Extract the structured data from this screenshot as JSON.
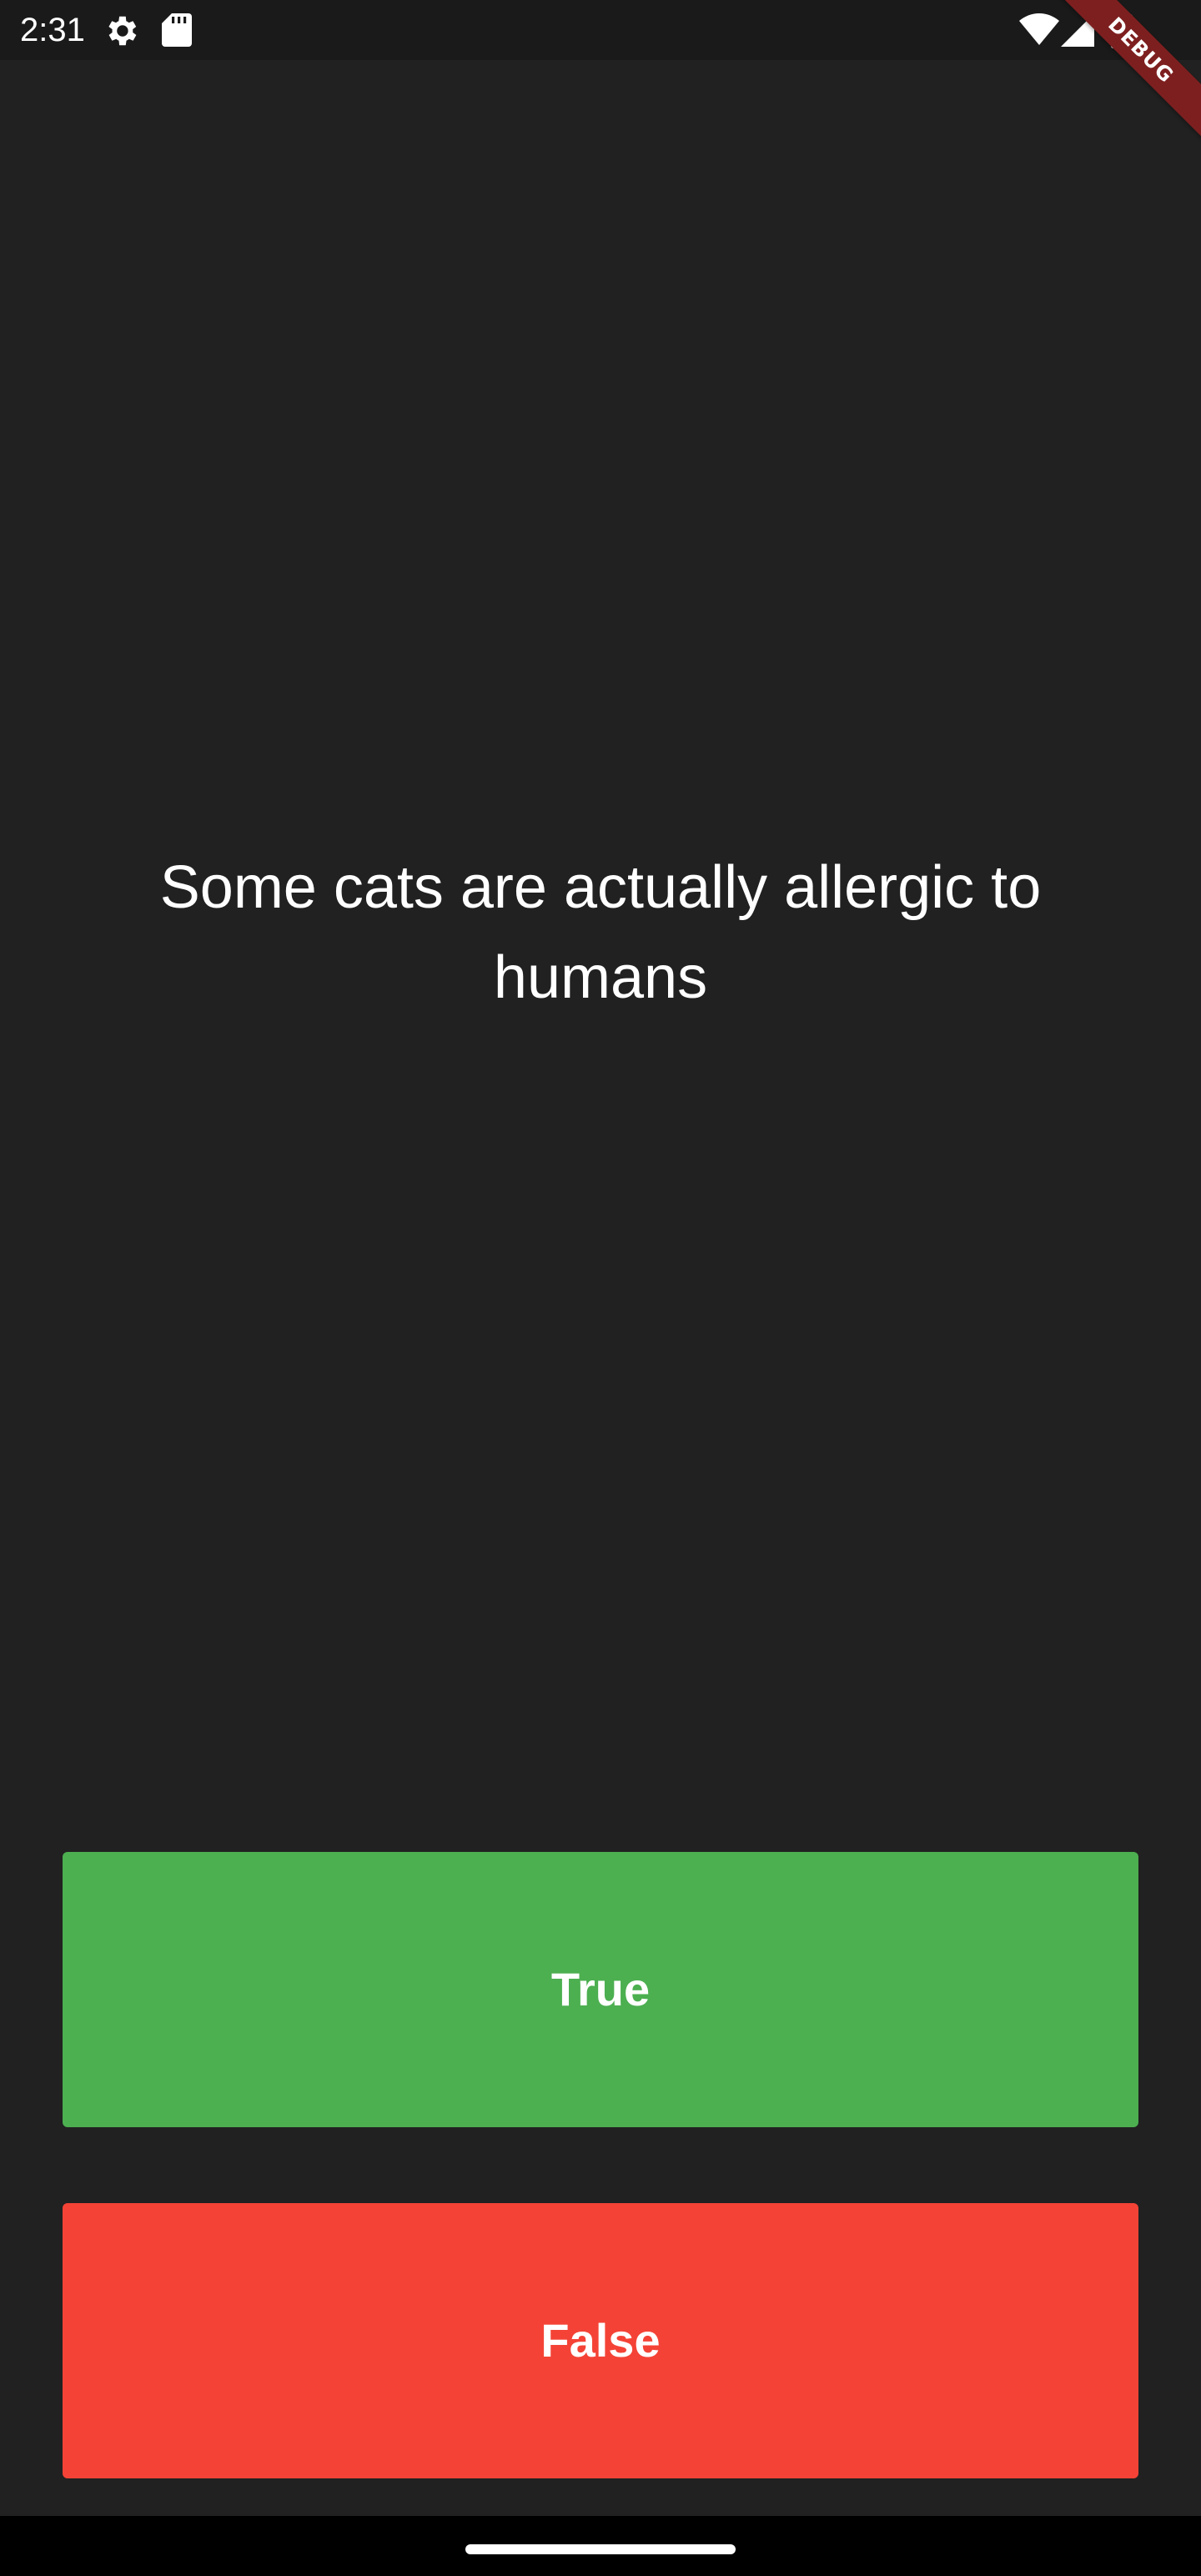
{
  "status_bar": {
    "time": "2:31",
    "icons": [
      "settings-gear-icon",
      "sd-card-icon",
      "wifi-icon",
      "signal-icon",
      "battery-icon"
    ]
  },
  "debug_banner": {
    "label": "DEBUG"
  },
  "quiz": {
    "question": "Some cats are actually allergic to humans",
    "true_label": "True",
    "false_label": "False"
  },
  "colors": {
    "background": "#212121",
    "true_button": "#4caf50",
    "false_button": "#f44336",
    "debug_ribbon": "#7e1f1f"
  }
}
